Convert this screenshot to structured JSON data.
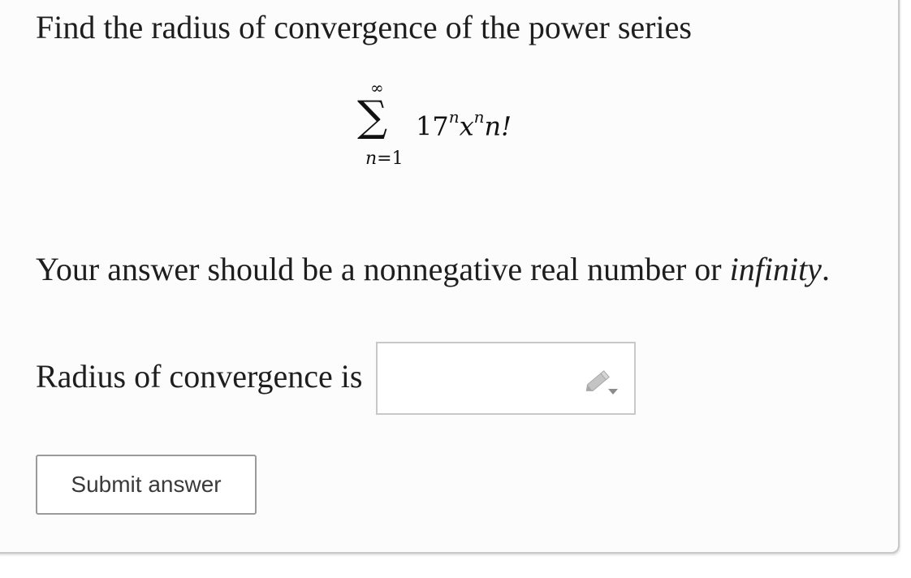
{
  "question": {
    "prompt": "Find the radius of convergence of the power series",
    "series": {
      "upper_limit": "∞",
      "sigma": "∑",
      "index_var": "n",
      "index_eq": "=",
      "index_start": "1",
      "coefficient": "17",
      "coef_exp": "n",
      "variable": "x",
      "var_exp": "n",
      "factorial": "n!"
    },
    "instructions_prefix": "Your answer should be a nonnegative real number or ",
    "instructions_emphasis": "infinity",
    "instructions_suffix": "."
  },
  "answer": {
    "label": "Radius of convergence is",
    "value": "",
    "placeholder": "",
    "icon": "pencil-icon"
  },
  "actions": {
    "submit_label": "Submit answer"
  },
  "colors": {
    "card_background": "#fcfcfc",
    "border": "#c8c8c8",
    "text": "#1e1e1e",
    "pencil": "#b4b4b4"
  }
}
